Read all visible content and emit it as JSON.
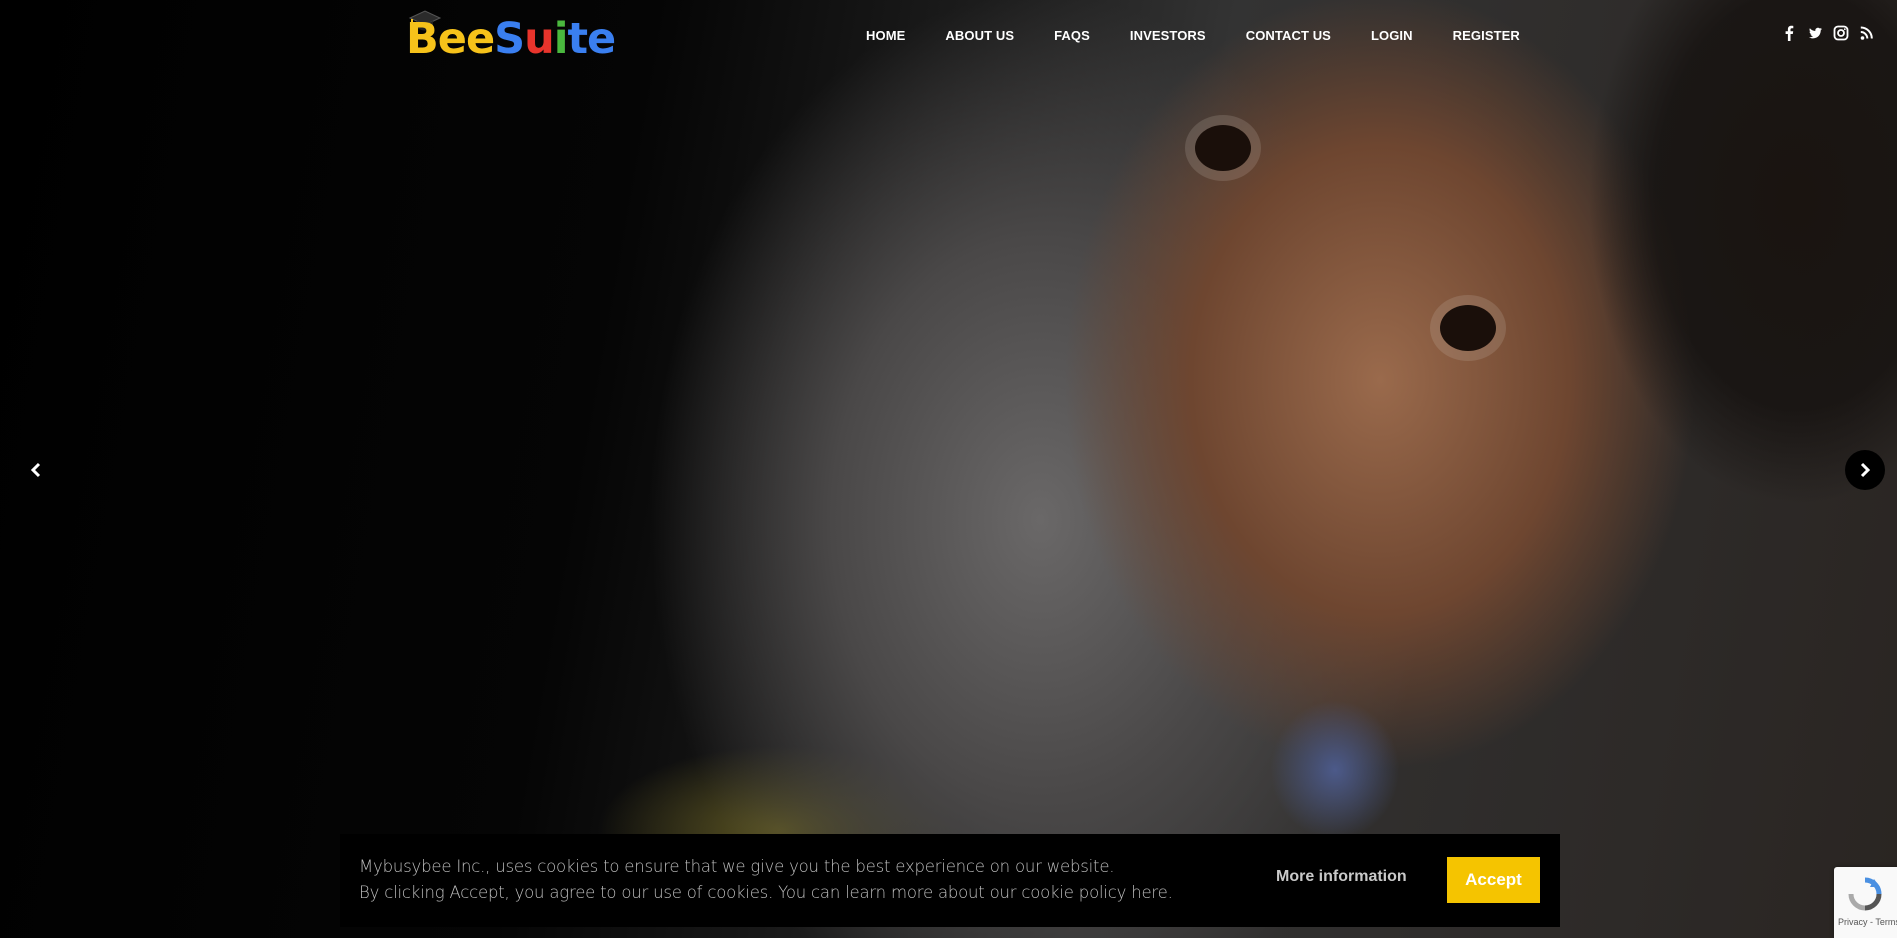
{
  "brand": {
    "letters": [
      "B",
      "e",
      "e",
      "S",
      "u",
      "i",
      "t",
      "e"
    ],
    "colors": {
      "yellow": "#f6c21a",
      "blue": "#3a7ff0",
      "red": "#e8342c",
      "green": "#4ab83e"
    }
  },
  "nav": {
    "items": [
      {
        "label": "HOME"
      },
      {
        "label": "ABOUT US"
      },
      {
        "label": "FAQS"
      },
      {
        "label": "INVESTORS"
      },
      {
        "label": "CONTACT US"
      },
      {
        "label": "LOGIN"
      },
      {
        "label": "REGISTER"
      }
    ]
  },
  "social": {
    "icons": [
      "facebook-icon",
      "twitter-icon",
      "instagram-icon",
      "rss-icon"
    ]
  },
  "slider": {
    "prev_icon": "chevron-left-icon",
    "next_icon": "chevron-right-icon"
  },
  "cookie": {
    "line1": "Mybusybee Inc., uses cookies to ensure that we give you the best experience on our website.",
    "line2": "By clicking Accept, you agree to our use of cookies. You can learn more about our cookie policy here.",
    "more_info": "More information",
    "accept": "Accept",
    "accent_color": "#f5c400"
  },
  "recaptcha": {
    "terms": "Privacy - Terms"
  }
}
